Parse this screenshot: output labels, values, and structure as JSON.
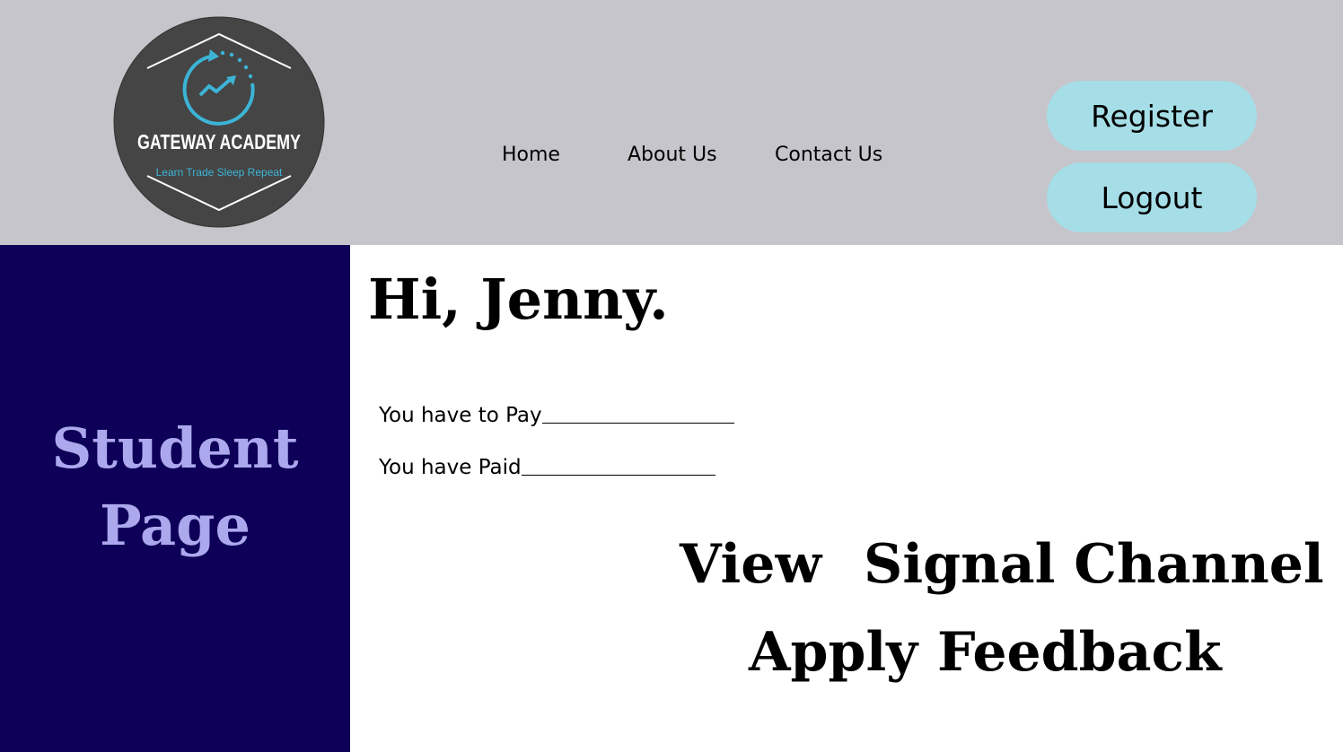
{
  "logo": {
    "name": "GATEWAY ACADEMY",
    "tagline": "Learn Trade Sleep Repeat",
    "colors": {
      "circle": "#454545",
      "accent": "#3cb4d6",
      "text": "#ffffff"
    }
  },
  "nav": {
    "home": "Home",
    "about": "About Us",
    "contact": "Contact Us"
  },
  "auth": {
    "register": "Register",
    "logout": "Logout"
  },
  "sidebar": {
    "title_line1": "Student",
    "title_line2": "Page"
  },
  "main": {
    "greeting": "Hi, Jenny.",
    "pay_label": "You have to Pay",
    "paid_label": "You have Paid",
    "actions": {
      "view": "View",
      "signal_channel": "Signal Channel",
      "apply": "Apply",
      "feedback": "Feedback"
    }
  },
  "colors": {
    "header_bg": "#c6c5cb",
    "sidebar_bg": "#0e0058",
    "sidebar_text": "#aca8ee",
    "button_bg": "#a5dee7"
  }
}
